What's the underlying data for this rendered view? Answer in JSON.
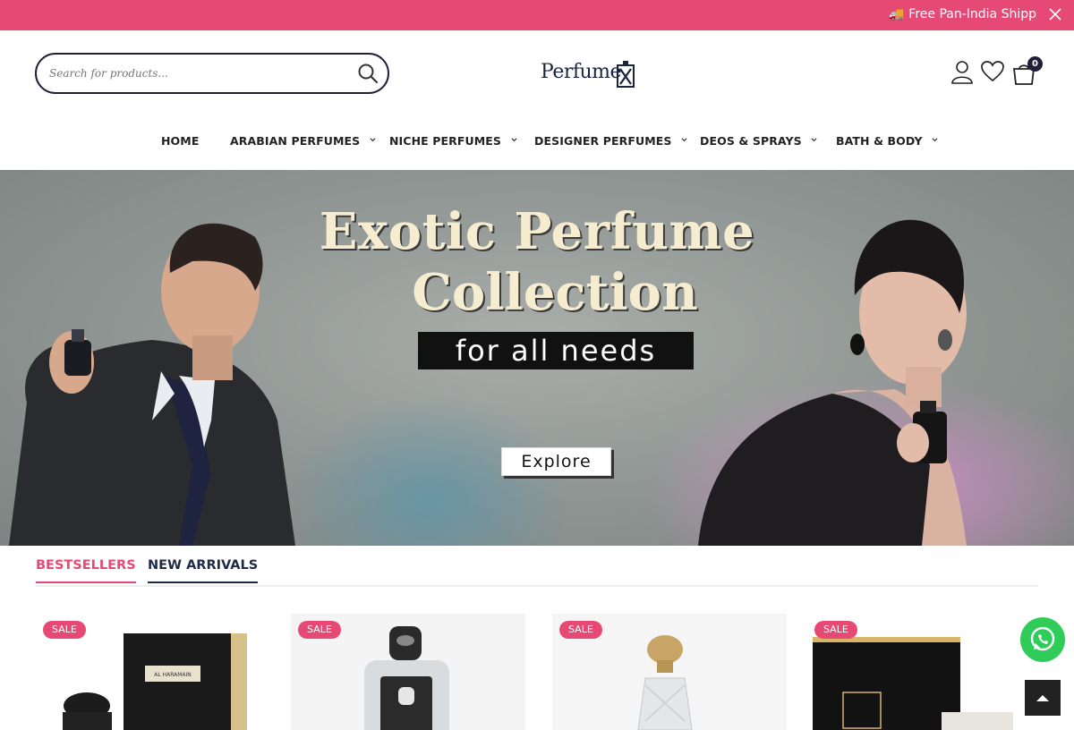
{
  "topbar": {
    "message": "🚚 Free Pan-India Shipp"
  },
  "search": {
    "placeholder": "Search for products..."
  },
  "logo": {
    "text": "Perfume"
  },
  "cart": {
    "count": "0"
  },
  "nav": {
    "items": [
      {
        "label": "HOME"
      },
      {
        "label": "ARABIAN PERFUMES"
      },
      {
        "label": "NICHE PERFUMES"
      },
      {
        "label": "DESIGNER PERFUMES"
      },
      {
        "label": "DEOS & SPRAYS"
      },
      {
        "label": "BATH & BODY"
      }
    ]
  },
  "hero": {
    "title_line1": "Exotic Perfume",
    "title_line2": "Collection",
    "subtitle": "for all needs",
    "cta": "Explore"
  },
  "tabs": [
    {
      "label": "BESTSELLERS",
      "active": true
    },
    {
      "label": "NEW ARRIVALS",
      "active": false
    }
  ],
  "products": [
    {
      "badge": "SALE",
      "box_label": "AL HARAMAIN"
    },
    {
      "badge": "SALE",
      "box_label": ""
    },
    {
      "badge": "SALE",
      "box_label": ""
    },
    {
      "badge": "SALE",
      "box_label": ""
    }
  ],
  "colors": {
    "accent": "#e64a74",
    "navy": "#1f2a48",
    "whatsapp": "#2fcc5a"
  }
}
